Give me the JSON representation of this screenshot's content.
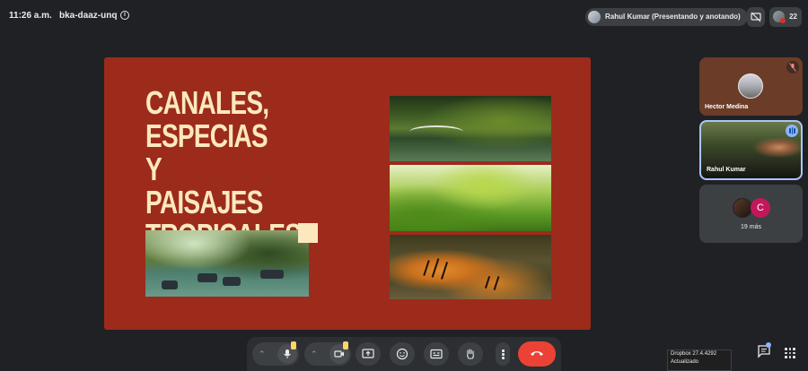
{
  "topbar": {
    "time": "11:26 a.m.",
    "meeting_code": "bka-daaz-unq",
    "presenter_chip": "Rahul Kumar (Presentando y anotando)",
    "participant_count": "22"
  },
  "slide": {
    "title_lines": [
      "CANALES,",
      "ESPECIAS Y",
      "PAISAJES",
      "TROPICALES"
    ],
    "background_color": "#9c2b1c",
    "title_color": "#fbe8be"
  },
  "tiles": {
    "hector": {
      "name": "Hector Medina"
    },
    "rahul": {
      "name": "Rahul Kumar"
    },
    "more": {
      "avatar_letter": "C",
      "label": "19 más"
    }
  },
  "controls": {
    "buttons": [
      "mic-options",
      "microphone",
      "camera-options",
      "camera",
      "present-screen",
      "emoji-reactions",
      "captions",
      "raise-hand",
      "more-options",
      "leave-call"
    ]
  },
  "toast": {
    "line1": "Dropbox 27.4.4292",
    "line2": "Actualizado"
  },
  "colors": {
    "hangup": "#ea4335",
    "accent": "#8ab4f8",
    "badge": "#c2185b"
  }
}
